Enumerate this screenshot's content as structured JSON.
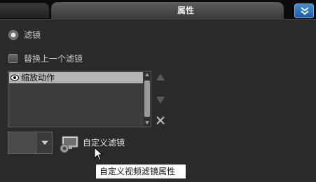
{
  "tabs": {
    "active_label": "属性"
  },
  "options": {
    "filter_radio_label": "滤镜",
    "replace_checkbox_label": "替换上一个滤镜"
  },
  "filter_list": {
    "items": [
      {
        "label": "缩放动作",
        "selected": true
      }
    ]
  },
  "toolbar": {
    "custom_filter_label": "自定义滤镜",
    "tooltip": "自定义视频滤镜属性"
  },
  "colors": {
    "accent": "#2f74c7",
    "panel": "#2a2a2a",
    "selection": "#b5b5b5"
  },
  "icons": {
    "collapse": "double-chevron-down-icon",
    "move_up": "triangle-up-icon",
    "move_down": "triangle-down-icon",
    "remove": "close-icon",
    "custom_filter": "gear-monitor-icon",
    "item": "eye-icon"
  }
}
